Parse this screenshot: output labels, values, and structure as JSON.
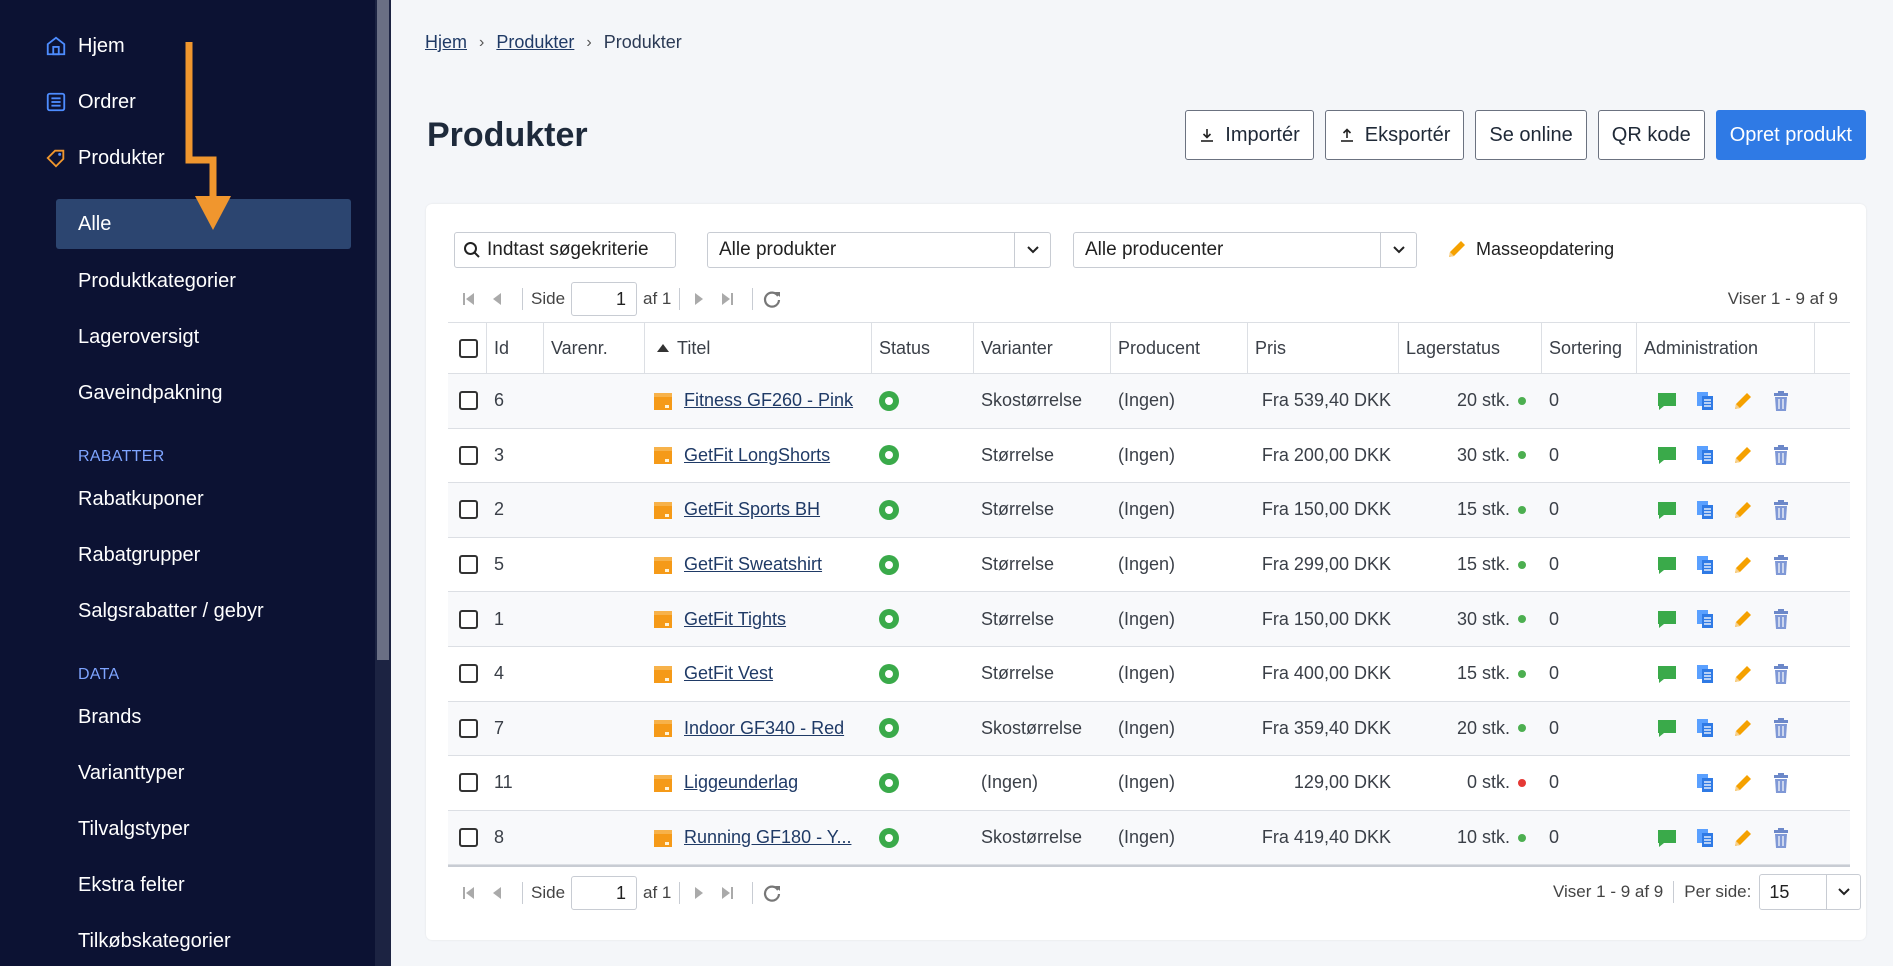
{
  "sidebar": {
    "top_items": [
      {
        "label": "Hjem",
        "icon": "home-icon"
      },
      {
        "label": "Ordrer",
        "icon": "list-icon"
      },
      {
        "label": "Produkter",
        "icon": "tag-icon"
      }
    ],
    "sub_items": [
      {
        "label": "Alle",
        "active": true
      },
      {
        "label": "Produktkategorier"
      },
      {
        "label": "Lageroversigt"
      },
      {
        "label": "Gaveindpakning"
      }
    ],
    "section_rabatter": "RABATTER",
    "rabatter_items": [
      "Rabatkuponer",
      "Rabatgrupper",
      "Salgsrabatter / gebyr"
    ],
    "section_data": "DATA",
    "data_items": [
      "Brands",
      "Varianttyper",
      "Tilvalgstyper",
      "Ekstra felter",
      "Tilkøbskategorier"
    ]
  },
  "breadcrumb": {
    "home": "Hjem",
    "level1": "Produkter",
    "current": "Produkter"
  },
  "page_title": "Produkter",
  "toolbar": {
    "import_label": "Importér",
    "export_label": "Eksportér",
    "online_label": "Se online",
    "qr_label": "QR kode",
    "create_label": "Opret produkt"
  },
  "filters": {
    "search_placeholder": "Indtast søgekriterie",
    "product_filter": "Alle produkter",
    "producer_filter": "Alle producenter",
    "mass_update": "Masseopdatering"
  },
  "pager": {
    "page_label": "Side",
    "page_value": "1",
    "of_label": "af 1",
    "showing": "Viser 1 - 9 af 9",
    "per_page_label": "Per side:",
    "per_page_value": "15"
  },
  "table": {
    "columns": [
      "Id",
      "Varenr.",
      "Titel",
      "Status",
      "Varianter",
      "Producent",
      "Pris",
      "Lagerstatus",
      "Sortering",
      "Administration"
    ],
    "rows": [
      {
        "id": "6",
        "varenr": "",
        "title": "Fitness GF260 - Pink",
        "variant": "Skostørrelse",
        "producer": "(Ingen)",
        "price": "Fra 539,40 DKK",
        "stock": "20 stk.",
        "stock_color": "#4caf50",
        "sort": "0",
        "has_comment": true
      },
      {
        "id": "3",
        "varenr": "",
        "title": "GetFit LongShorts",
        "variant": "Størrelse",
        "producer": "(Ingen)",
        "price": "Fra 200,00 DKK",
        "stock": "30 stk.",
        "stock_color": "#4caf50",
        "sort": "0",
        "has_comment": true
      },
      {
        "id": "2",
        "varenr": "",
        "title": "GetFit Sports BH",
        "variant": "Størrelse",
        "producer": "(Ingen)",
        "price": "Fra 150,00 DKK",
        "stock": "15 stk.",
        "stock_color": "#4caf50",
        "sort": "0",
        "has_comment": true
      },
      {
        "id": "5",
        "varenr": "",
        "title": "GetFit Sweatshirt",
        "variant": "Størrelse",
        "producer": "(Ingen)",
        "price": "Fra 299,00 DKK",
        "stock": "15 stk.",
        "stock_color": "#4caf50",
        "sort": "0",
        "has_comment": true
      },
      {
        "id": "1",
        "varenr": "",
        "title": "GetFit Tights",
        "variant": "Størrelse",
        "producer": "(Ingen)",
        "price": "Fra 150,00 DKK",
        "stock": "30 stk.",
        "stock_color": "#4caf50",
        "sort": "0",
        "has_comment": true
      },
      {
        "id": "4",
        "varenr": "",
        "title": "GetFit Vest",
        "variant": "Størrelse",
        "producer": "(Ingen)",
        "price": "Fra 400,00 DKK",
        "stock": "15 stk.",
        "stock_color": "#4caf50",
        "sort": "0",
        "has_comment": true
      },
      {
        "id": "7",
        "varenr": "",
        "title": "Indoor GF340 - Red",
        "variant": "Skostørrelse",
        "producer": "(Ingen)",
        "price": "Fra 359,40 DKK",
        "stock": "20 stk.",
        "stock_color": "#4caf50",
        "sort": "0",
        "has_comment": true
      },
      {
        "id": "11",
        "varenr": "",
        "title": "Liggeunderlag",
        "variant": "(Ingen)",
        "producer": "(Ingen)",
        "price": "129,00 DKK",
        "stock": "0 stk.",
        "stock_color": "#e53935",
        "sort": "0",
        "has_comment": false
      },
      {
        "id": "8",
        "varenr": "",
        "title": "Running GF180 - Y...",
        "variant": "Skostørrelse",
        "producer": "(Ingen)",
        "price": "Fra 419,40 DKK",
        "stock": "10 stk.",
        "stock_color": "#4caf50",
        "sort": "0",
        "has_comment": true
      }
    ]
  },
  "colors": {
    "sidebar_bg": "#0c1233",
    "active_item": "#2c4570",
    "primary": "#2f7ae5",
    "arrow": "#f0962e",
    "status_green": "#3aaa4a"
  }
}
